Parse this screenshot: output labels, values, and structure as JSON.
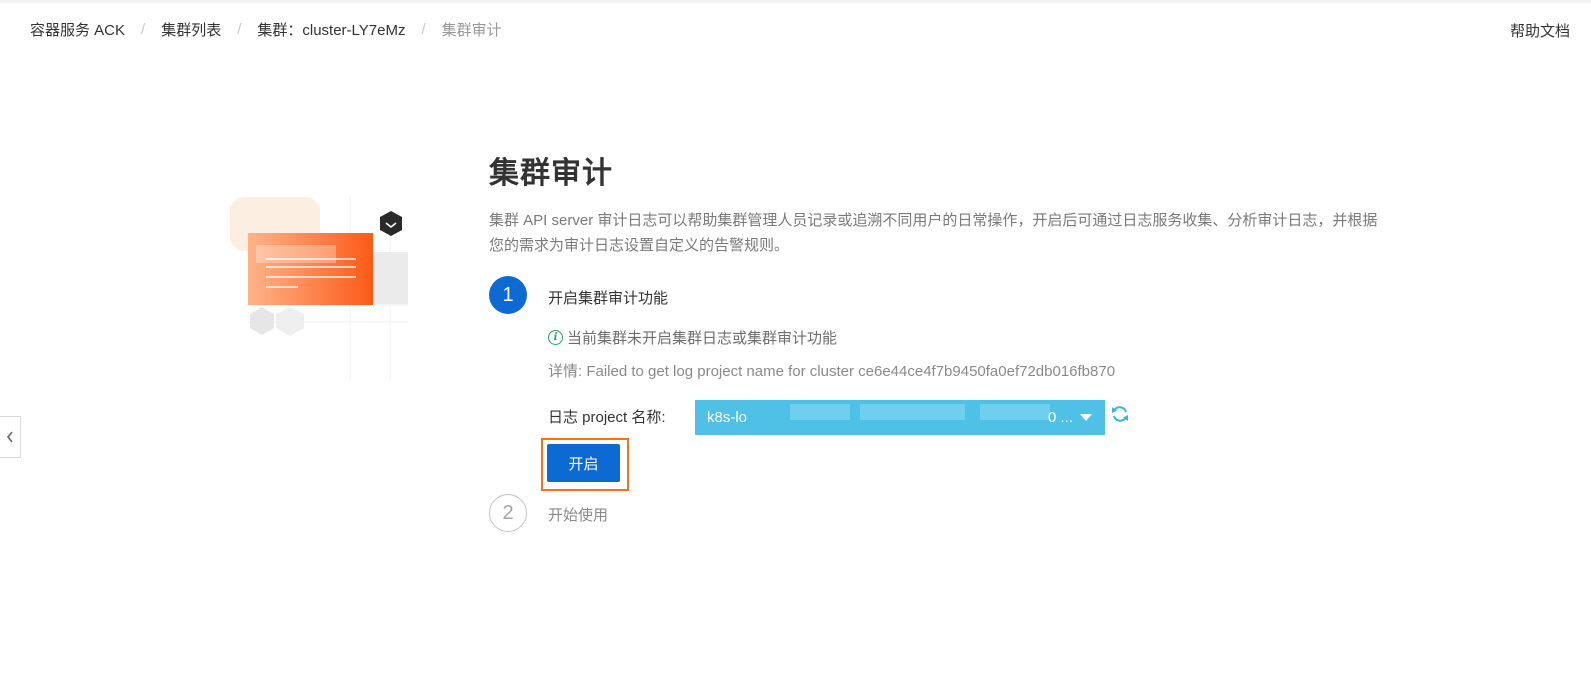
{
  "breadcrumb": {
    "items": [
      {
        "label": "容器服务 ACK"
      },
      {
        "label": "集群列表"
      },
      {
        "label": "集群：cluster-LY7eMz"
      },
      {
        "label": "集群审计"
      }
    ]
  },
  "header": {
    "help_label": "帮助文档"
  },
  "page": {
    "title": "集群审计",
    "description": "集群 API server 审计日志可以帮助集群管理人员记录或追溯不同用户的日常操作，开启后可通过日志服务收集、分析审计日志，并根据您的需求为审计日志设置自定义的告警规则。"
  },
  "steps": [
    {
      "number": "1",
      "label": "开启集群审计功能",
      "state": "active"
    },
    {
      "number": "2",
      "label": "开始使用",
      "state": "inactive"
    }
  ],
  "step1": {
    "notice": "当前集群未开启集群日志或集群审计功能",
    "detail": "详情: Failed to get log project name for cluster ce6e44ce4f7b9450fa0ef72db016fb870",
    "project_label": "日志 project 名称:",
    "project_value_start": "k8s-lo",
    "project_value_end": "0 ...",
    "enable_label": "开启"
  },
  "colors": {
    "primary": "#0d6ad2",
    "select_bg": "#4fc1e6",
    "highlight": "#f0731e",
    "info": "#27a35a"
  },
  "icons": {
    "notice": "info-icon",
    "refresh": "refresh-icon",
    "select_caret": "caret-down-icon",
    "side_toggle": "chevron-left-icon"
  }
}
